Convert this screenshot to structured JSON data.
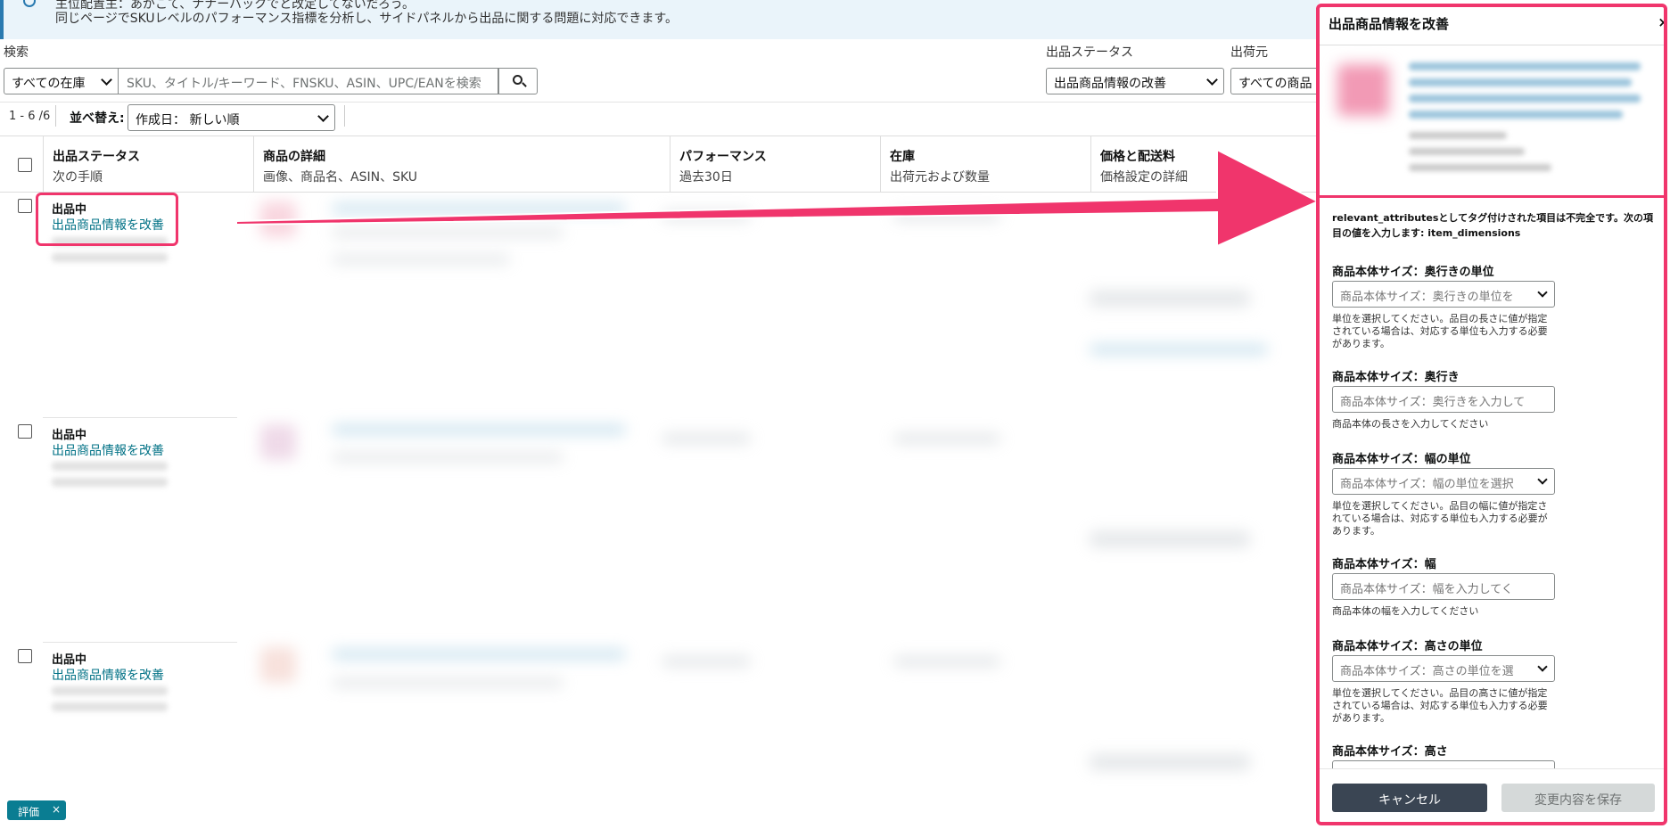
{
  "banner": {
    "line1": "主位配置主：あがこて、ナナーバックでと改定してないだろう。",
    "line2": "同じページでSKUレベルのパフォーマンス指標を分析し、サイドパネルから出品に関する問題に対応できます。"
  },
  "filters": {
    "search_label": "検索",
    "inventory_select": "すべての在庫",
    "search_placeholder": "SKU、タイトル/キーワード、FNSKU、ASIN、UPC/EANを検索",
    "status_label": "出品ステータス",
    "status_select": "出品商品情報の改善",
    "ship_label": "出荷元",
    "ship_select": "すべての商品"
  },
  "toolbar": {
    "count": "1 - 6 /6",
    "sort_label": "並べ替え:",
    "sort_select": "作成日： 新しい順"
  },
  "table": {
    "columns": [
      {
        "title": "出品ステータス",
        "sub": "次の手順"
      },
      {
        "title": "商品の詳細",
        "sub": "画像、商品名、ASIN、SKU"
      },
      {
        "title": "パフォーマンス",
        "sub": "過去30日"
      },
      {
        "title": "在庫",
        "sub": "出荷元および数量"
      },
      {
        "title": "価格と配送料",
        "sub": "価格設定の詳細"
      }
    ],
    "rows": [
      {
        "status": "出品中",
        "action": "出品商品情報を改善"
      },
      {
        "status": "出品中",
        "action": "出品商品情報を改善"
      },
      {
        "status": "出品中",
        "action": "出品商品情報を改善"
      }
    ]
  },
  "badge": {
    "label": "評価",
    "close": "×"
  },
  "panel": {
    "title": "出品商品情報を改善",
    "close": "×",
    "message": "relevant_attributesとしてタグ付けされた項目は不完全です。次の項目の値を入力します: item_dimensions",
    "fields": [
      {
        "label": "商品本体サイズ：奥行きの単位",
        "placeholder": "商品本体サイズ：奥行きの単位を",
        "help": "単位を選択してください。品目の長さに値が指定されている場合は、対応する単位も入力する必要があります。"
      },
      {
        "label": "商品本体サイズ：奥行き",
        "placeholder": "商品本体サイズ：奥行きを入力して",
        "help": "商品本体の長さを入力してください"
      },
      {
        "label": "商品本体サイズ：幅の単位",
        "placeholder": "商品本体サイズ：幅の単位を選択",
        "help": "単位を選択してください。品目の幅に値が指定されている場合は、対応する単位も入力する必要があります。"
      },
      {
        "label": "商品本体サイズ：幅",
        "placeholder": "商品本体サイズ：幅を入力してく",
        "help": "商品本体の幅を入力してください"
      },
      {
        "label": "商品本体サイズ：高さの単位",
        "placeholder": "商品本体サイズ：高さの単位を選",
        "help": "単位を選択してください。品目の高さに値が指定されている場合は、対応する単位も入力する必要があります。"
      },
      {
        "label": "商品本体サイズ：高さ"
      }
    ],
    "cancel": "キャンセル",
    "save": "変更内容を保存"
  },
  "colors": {
    "highlight": "#f0356c",
    "link": "#007185",
    "cancel_bg": "#3a4553"
  }
}
